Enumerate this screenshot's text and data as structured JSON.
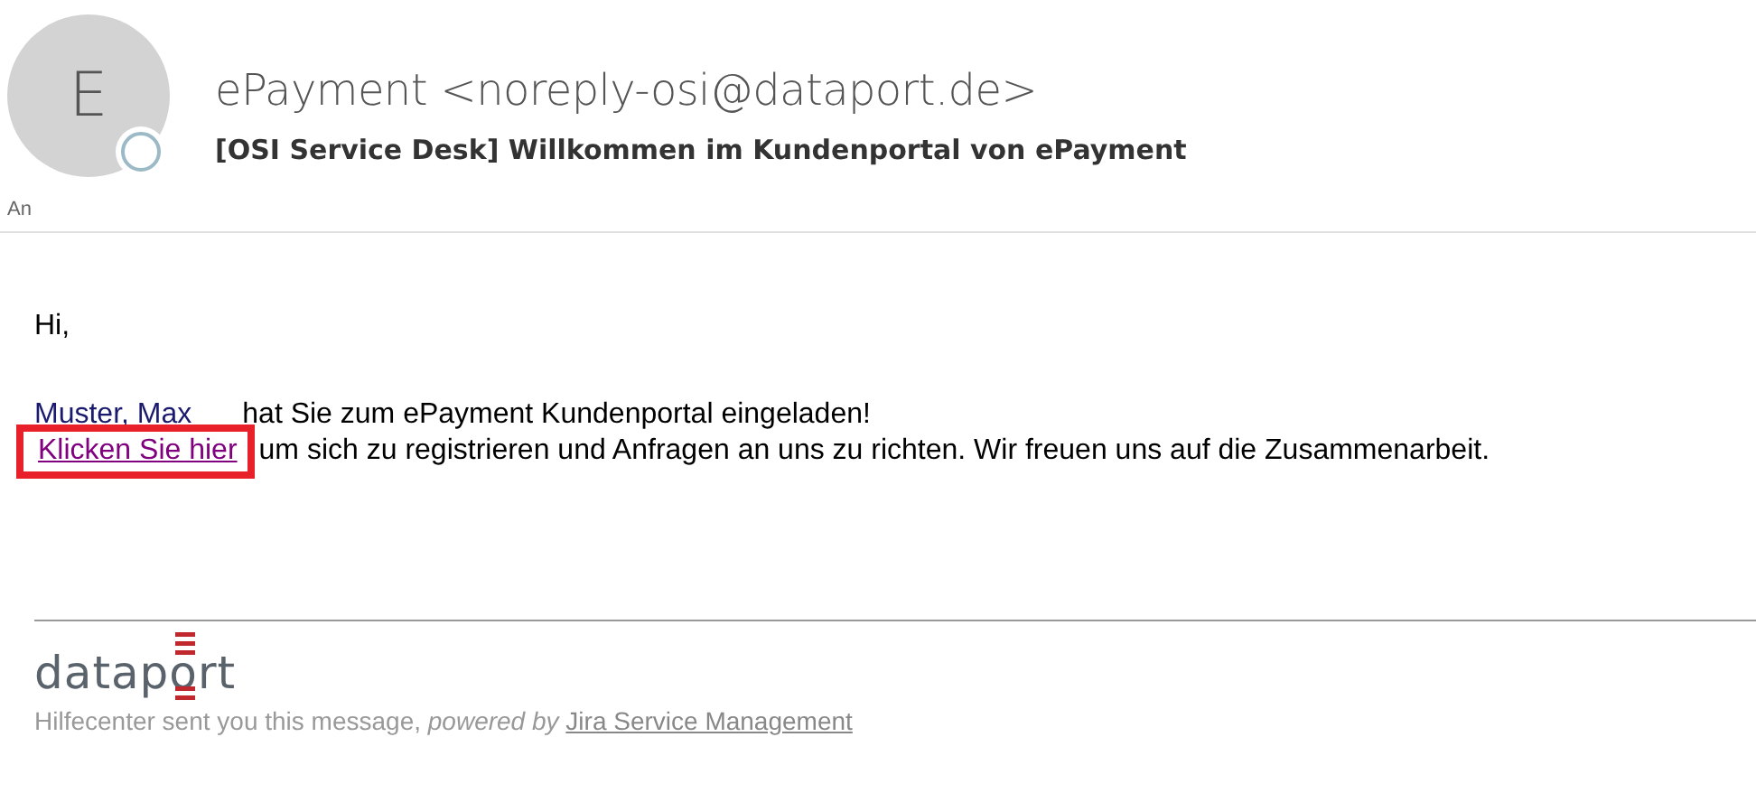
{
  "header": {
    "avatar_initial": "E",
    "sender": "ePayment <noreply-osi@dataport.de>",
    "subject": "[OSI Service Desk] Willkommen im Kundenportal von ePayment",
    "to_label": "An"
  },
  "body": {
    "greeting": "Hi,",
    "mention": "Muster, Max",
    "invite_text": "hat Sie zum ePayment Kundenportal eingeladen!",
    "link": {
      "text": "Klicken Sie hier",
      "highlighted": true
    },
    "link_rest": "um sich zu registrieren und Anfragen an uns zu richten. Wir freuen uns auf die Zusammenarbeit."
  },
  "footer": {
    "logo": "dataport",
    "note": "Hilfecenter sent you this message, *powered by*",
    "note_link": "Jira Service Management"
  }
}
